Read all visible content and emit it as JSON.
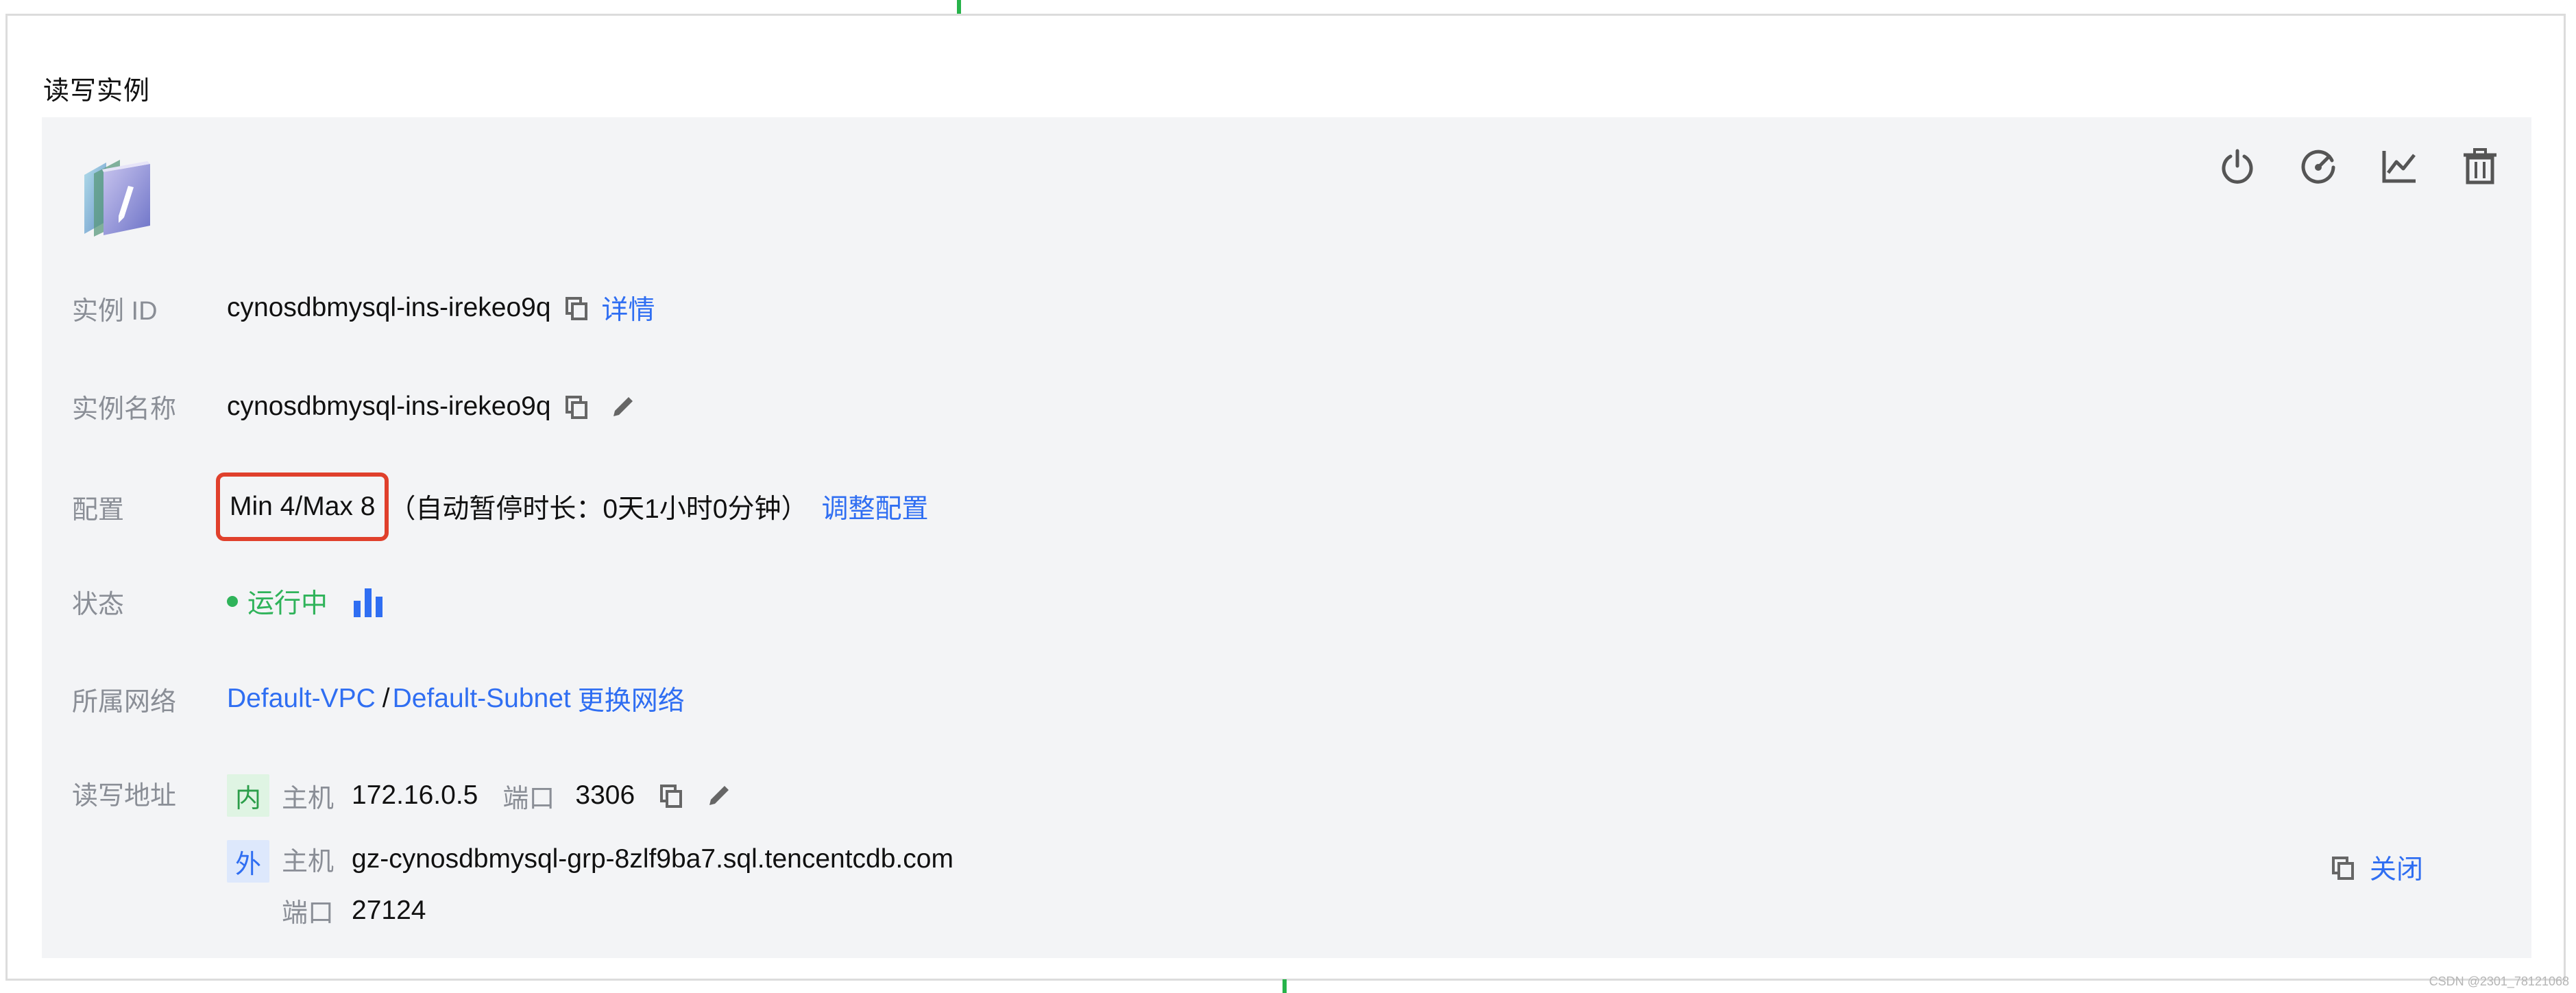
{
  "section": {
    "title": "读写实例"
  },
  "toolbar": {
    "icons": [
      "power-icon",
      "gauge-icon",
      "line-chart-icon",
      "trash-icon"
    ]
  },
  "instance_id": {
    "label": "实例 ID",
    "value": "cynosdbmysql-ins-irekeo9q",
    "detail_link": "详情"
  },
  "instance_name": {
    "label": "实例名称",
    "value": "cynosdbmysql-ins-irekeo9q"
  },
  "config": {
    "label": "配置",
    "value": "Min 4/Max 8",
    "auto_pause": "（自动暂停时长：0天1小时0分钟）",
    "adjust_link": "调整配置",
    "highlight_color": "#e0402c"
  },
  "status": {
    "label": "状态",
    "value": "运行中",
    "color": "#2fb35a"
  },
  "network": {
    "label": "所属网络",
    "vpc": "Default-VPC",
    "separator": "/",
    "subnet": "Default-Subnet",
    "change_link": "更换网络"
  },
  "address": {
    "label": "读写地址",
    "internal": {
      "tag": "内",
      "host_label": "主机",
      "host": "172.16.0.5",
      "port_label": "端口",
      "port": "3306"
    },
    "external": {
      "tag": "外",
      "host_label": "主机",
      "host": "gz-cynosdbmysql-grp-8zlf9ba7.sql.tencentcdb.com",
      "port_label": "端口",
      "port": "27124",
      "close_link": "关闭"
    }
  },
  "colors": {
    "link": "#2f6ef2",
    "label": "#8a8e96",
    "card_bg": "#f3f4f6"
  },
  "watermark": "CSDN @2301_78121068"
}
